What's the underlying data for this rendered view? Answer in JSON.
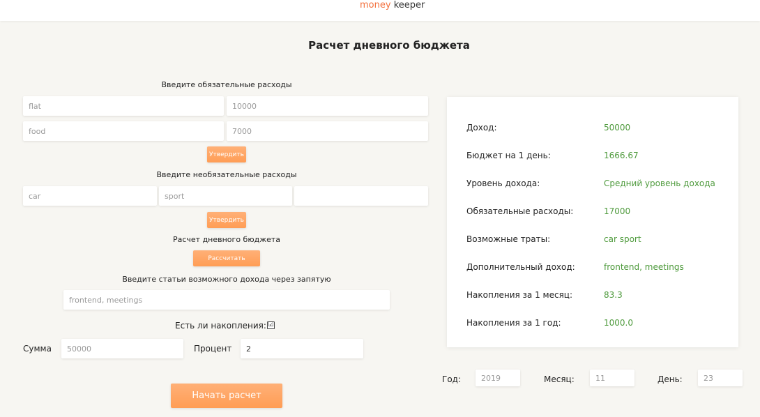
{
  "header": {
    "logo_a": "money",
    "logo_b": "keeper"
  },
  "title": "Расчет дневного бюджета",
  "mandatory": {
    "label": "Введите обязательные расходы",
    "items": [
      {
        "name": "flat",
        "amount": "10000"
      },
      {
        "name": "food",
        "amount": "7000"
      }
    ],
    "button": "Утвердить"
  },
  "optional": {
    "label": "Введите необязательные расходы",
    "items": [
      "car",
      "sport",
      ""
    ],
    "button": "Утвердить"
  },
  "calc": {
    "label": "Расчет дневного бюджета",
    "button": "Рассчитать"
  },
  "income_sources": {
    "label": "Введите статьи возможного дохода через запятую",
    "value": "frontend, meetings"
  },
  "savings": {
    "label": "Есть ли накопления:",
    "checked": true,
    "check_glyph": "☑"
  },
  "amount": {
    "label": "Сумма",
    "value": "50000"
  },
  "percent": {
    "label": "Процент",
    "value": "2"
  },
  "start_button": "Начать расчет",
  "summary": [
    {
      "label": "Доход:",
      "value": "50000"
    },
    {
      "label": "Бюджет на 1 день:",
      "value": "1666.67"
    },
    {
      "label": "Уровень дохода:",
      "value": "Средний уровень дохода"
    },
    {
      "label": "Обязательные расходы:",
      "value": "17000"
    },
    {
      "label": "Возможные траты:",
      "value": "car sport"
    },
    {
      "label": "Дополнительный доход:",
      "value": "frontend, meetings"
    },
    {
      "label": "Накопления за 1 месяц:",
      "value": "83.3"
    },
    {
      "label": "Накопления за 1 год:",
      "value": "1000.0"
    }
  ],
  "date": {
    "year_label": "Год:",
    "year": "2019",
    "month_label": "Месяц:",
    "month": "11",
    "day_label": "День:",
    "day": "23"
  },
  "colors": {
    "accent": "#ff9d55",
    "value_green": "#4e9a3c",
    "brand": "#f36f3b"
  }
}
